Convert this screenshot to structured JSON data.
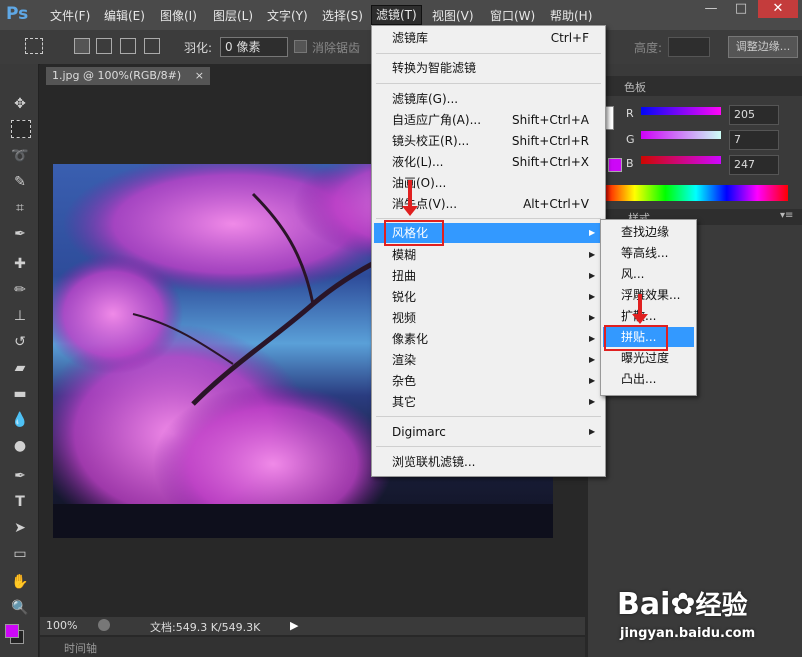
{
  "app": {
    "logo": "Ps"
  },
  "menubar": {
    "items": [
      {
        "label": "文件(F)"
      },
      {
        "label": "编辑(E)"
      },
      {
        "label": "图像(I)"
      },
      {
        "label": "图层(L)"
      },
      {
        "label": "文字(Y)"
      },
      {
        "label": "选择(S)"
      },
      {
        "label": "滤镜(T)"
      },
      {
        "label": "视图(V)"
      },
      {
        "label": "窗口(W)"
      },
      {
        "label": "帮助(H)"
      }
    ]
  },
  "window_controls": {
    "minimize": "—",
    "restore": "□",
    "close": "✕"
  },
  "optionsbar": {
    "feather_label": "羽化:",
    "feather_value": "0 像素",
    "antialias_label": "消除锯齿",
    "height_label": "高度:",
    "adjust_edge_label": "调整边缘..."
  },
  "document": {
    "tab_title": "1.jpg @ 100%(RGB/8#)",
    "tab_close": "×",
    "zoom": "100%",
    "doc_info": "文档:549.3 K/549.3K",
    "timeline_label": "时间轴"
  },
  "color_panel": {
    "tab_color": "色板",
    "r_label": "R",
    "r_value": "205",
    "g_label": "G",
    "g_value": "7",
    "b_label": "B",
    "b_value": "247",
    "styles_tab": "样式",
    "fg_color": "#cd07f7"
  },
  "filter_menu": {
    "items": [
      {
        "label": "滤镜库",
        "shortcut": "Ctrl+F"
      },
      {
        "label": "转换为智能滤镜",
        "shortcut": ""
      },
      {
        "label": "滤镜库(G)...",
        "shortcut": ""
      },
      {
        "label": "自适应广角(A)...",
        "shortcut": "Shift+Ctrl+A"
      },
      {
        "label": "镜头校正(R)...",
        "shortcut": "Shift+Ctrl+R"
      },
      {
        "label": "液化(L)...",
        "shortcut": "Shift+Ctrl+X"
      },
      {
        "label": "油画(O)...",
        "shortcut": ""
      },
      {
        "label": "消失点(V)...",
        "shortcut": "Alt+Ctrl+V"
      },
      {
        "label": "风格化",
        "shortcut": ""
      },
      {
        "label": "模糊",
        "shortcut": ""
      },
      {
        "label": "扭曲",
        "shortcut": ""
      },
      {
        "label": "锐化",
        "shortcut": ""
      },
      {
        "label": "视频",
        "shortcut": ""
      },
      {
        "label": "像素化",
        "shortcut": ""
      },
      {
        "label": "渲染",
        "shortcut": ""
      },
      {
        "label": "杂色",
        "shortcut": ""
      },
      {
        "label": "其它",
        "shortcut": ""
      },
      {
        "label": "Digimarc",
        "shortcut": ""
      },
      {
        "label": "浏览联机滤镜...",
        "shortcut": ""
      }
    ]
  },
  "stylize_submenu": {
    "items": [
      {
        "label": "查找边缘"
      },
      {
        "label": "等高线..."
      },
      {
        "label": "风..."
      },
      {
        "label": "浮雕效果..."
      },
      {
        "label": "扩散..."
      },
      {
        "label": "拼贴..."
      },
      {
        "label": "曝光过度"
      },
      {
        "label": "凸出..."
      }
    ]
  },
  "watermark": {
    "brand": "Bai",
    "brand2": "经验",
    "url": "jingyan.baidu.com"
  },
  "colors": {
    "menu_highlight": "#3399ff",
    "annotation_red": "#e02020"
  }
}
